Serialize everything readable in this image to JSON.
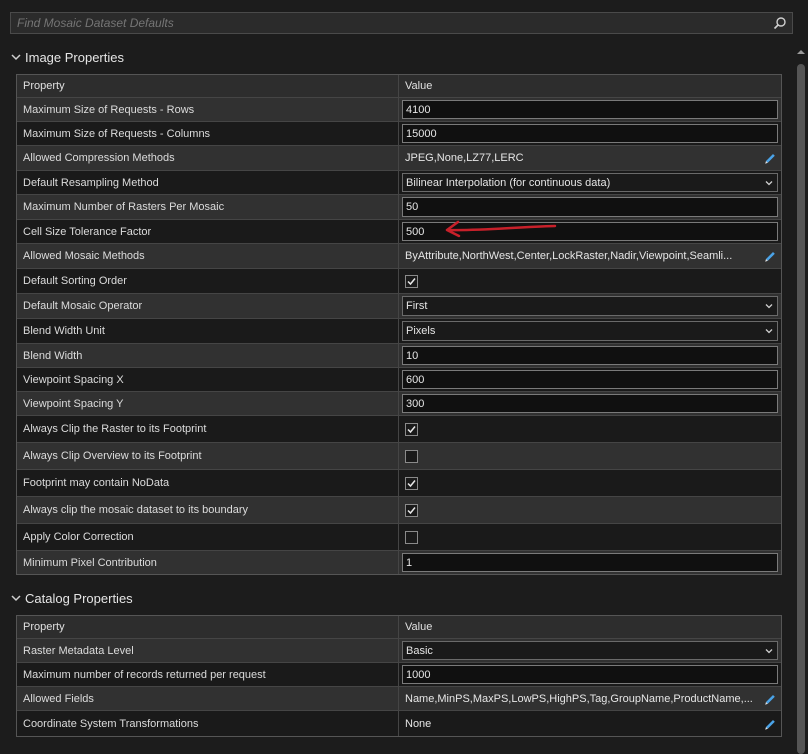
{
  "search": {
    "placeholder": "Find Mosaic Dataset Defaults",
    "icon": "search-icon"
  },
  "image_properties": {
    "title": "Image Properties",
    "header": {
      "property": "Property",
      "value": "Value"
    },
    "rows": [
      {
        "label": "Maximum Size of Requests - Rows",
        "kind": "input",
        "value": "4100"
      },
      {
        "label": "Maximum Size of Requests - Columns",
        "kind": "input",
        "value": "15000"
      },
      {
        "label": "Allowed Compression Methods",
        "kind": "text-edit",
        "value": "JPEG,None,LZ77,LERC"
      },
      {
        "label": "Default Resampling Method",
        "kind": "select",
        "value": "Bilinear Interpolation (for continuous data)"
      },
      {
        "label": "Maximum Number of Rasters Per Mosaic",
        "kind": "input",
        "value": "50"
      },
      {
        "label": "Cell Size Tolerance Factor",
        "kind": "input",
        "value": "500"
      },
      {
        "label": "Allowed Mosaic Methods",
        "kind": "text-edit",
        "value": "ByAttribute,NorthWest,Center,LockRaster,Nadir,Viewpoint,Seamli..."
      },
      {
        "label": "Default Sorting Order",
        "kind": "checkbox",
        "checked": true
      },
      {
        "label": "Default Mosaic Operator",
        "kind": "select",
        "value": "First"
      },
      {
        "label": "Blend Width Unit",
        "kind": "select",
        "value": "Pixels"
      },
      {
        "label": "Blend Width",
        "kind": "input",
        "value": "10"
      },
      {
        "label": "Viewpoint Spacing X",
        "kind": "input",
        "value": "600"
      },
      {
        "label": "Viewpoint Spacing Y",
        "kind": "input",
        "value": "300"
      },
      {
        "label": "Always Clip the Raster to its Footprint",
        "kind": "checkbox",
        "checked": true
      },
      {
        "label": "Always Clip Overview to its Footprint",
        "kind": "checkbox",
        "checked": false
      },
      {
        "label": "Footprint may contain NoData",
        "kind": "checkbox",
        "checked": true
      },
      {
        "label": "Always clip the mosaic dataset to its boundary",
        "kind": "checkbox",
        "checked": true
      },
      {
        "label": "Apply Color Correction",
        "kind": "checkbox",
        "checked": false
      },
      {
        "label": "Minimum Pixel Contribution",
        "kind": "input",
        "value": "1"
      }
    ]
  },
  "catalog_properties": {
    "title": "Catalog Properties",
    "header": {
      "property": "Property",
      "value": "Value"
    },
    "rows": [
      {
        "label": "Raster Metadata Level",
        "kind": "select",
        "value": "Basic"
      },
      {
        "label": "Maximum number of records returned per request",
        "kind": "input",
        "value": "1000"
      },
      {
        "label": "Allowed Fields",
        "kind": "text-edit",
        "value": "Name,MinPS,MaxPS,LowPS,HighPS,Tag,GroupName,ProductName,..."
      },
      {
        "label": "Coordinate System Transformations",
        "kind": "text-edit",
        "value": "None"
      }
    ]
  },
  "colors": {
    "background": "#1c1c1c",
    "row_alt": "#313131",
    "row_base": "#1a1a1a",
    "annotation_arrow": "#c8202a",
    "pencil_icon": "#4aa3e8"
  }
}
